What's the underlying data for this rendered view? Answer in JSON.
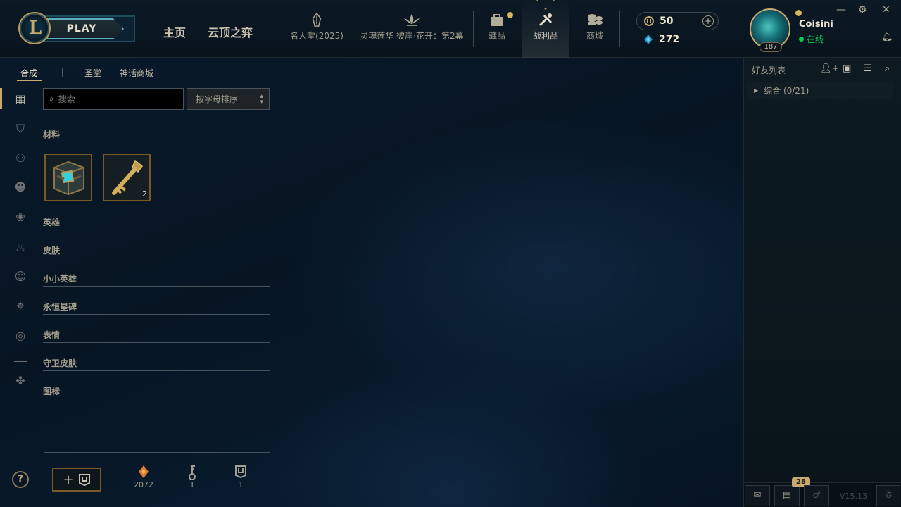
{
  "topbar": {
    "logo_letter": "L",
    "play_label": "PLAY",
    "nav_home": "主页",
    "nav_tft": "云顶之弈",
    "items": [
      {
        "label": "名人堂(2025)",
        "icon": "hall-of-legends-icon"
      },
      {
        "label": "灵魂莲华 彼岸·花开：第2幕",
        "icon": "lotus-event-icon"
      },
      {
        "label": "藏品",
        "icon": "collection-icon"
      },
      {
        "label": "战利品",
        "icon": "loot-icon"
      },
      {
        "label": "商城",
        "icon": "store-icon"
      }
    ],
    "rp": "50",
    "be": "272",
    "username": "Coisini",
    "status": "在线",
    "level": "187",
    "accent": "#c8aa6e",
    "online_color": "#0acb52"
  },
  "loot": {
    "tabs": [
      "合成",
      "圣堂",
      "神话商城"
    ],
    "search_placeholder": "搜索",
    "sort_label": "按字母排序",
    "categories": [
      "材料",
      "英雄",
      "皮肤",
      "小小英雄",
      "永恒星碑",
      "表情",
      "守卫皮肤",
      "图标"
    ],
    "materials": [
      {
        "name": "hextech-chest",
        "count": ""
      },
      {
        "name": "hextech-key",
        "count": "2"
      }
    ],
    "stats": [
      {
        "icon": "orange-essence-icon",
        "value": "2072"
      },
      {
        "icon": "key-fragment-icon",
        "value": "1"
      },
      {
        "icon": "chest-icon",
        "value": "1"
      }
    ],
    "help": "?"
  },
  "social": {
    "title": "好友列表",
    "group": "综合 (0/21)",
    "badge": "28",
    "version": "V15.13"
  }
}
